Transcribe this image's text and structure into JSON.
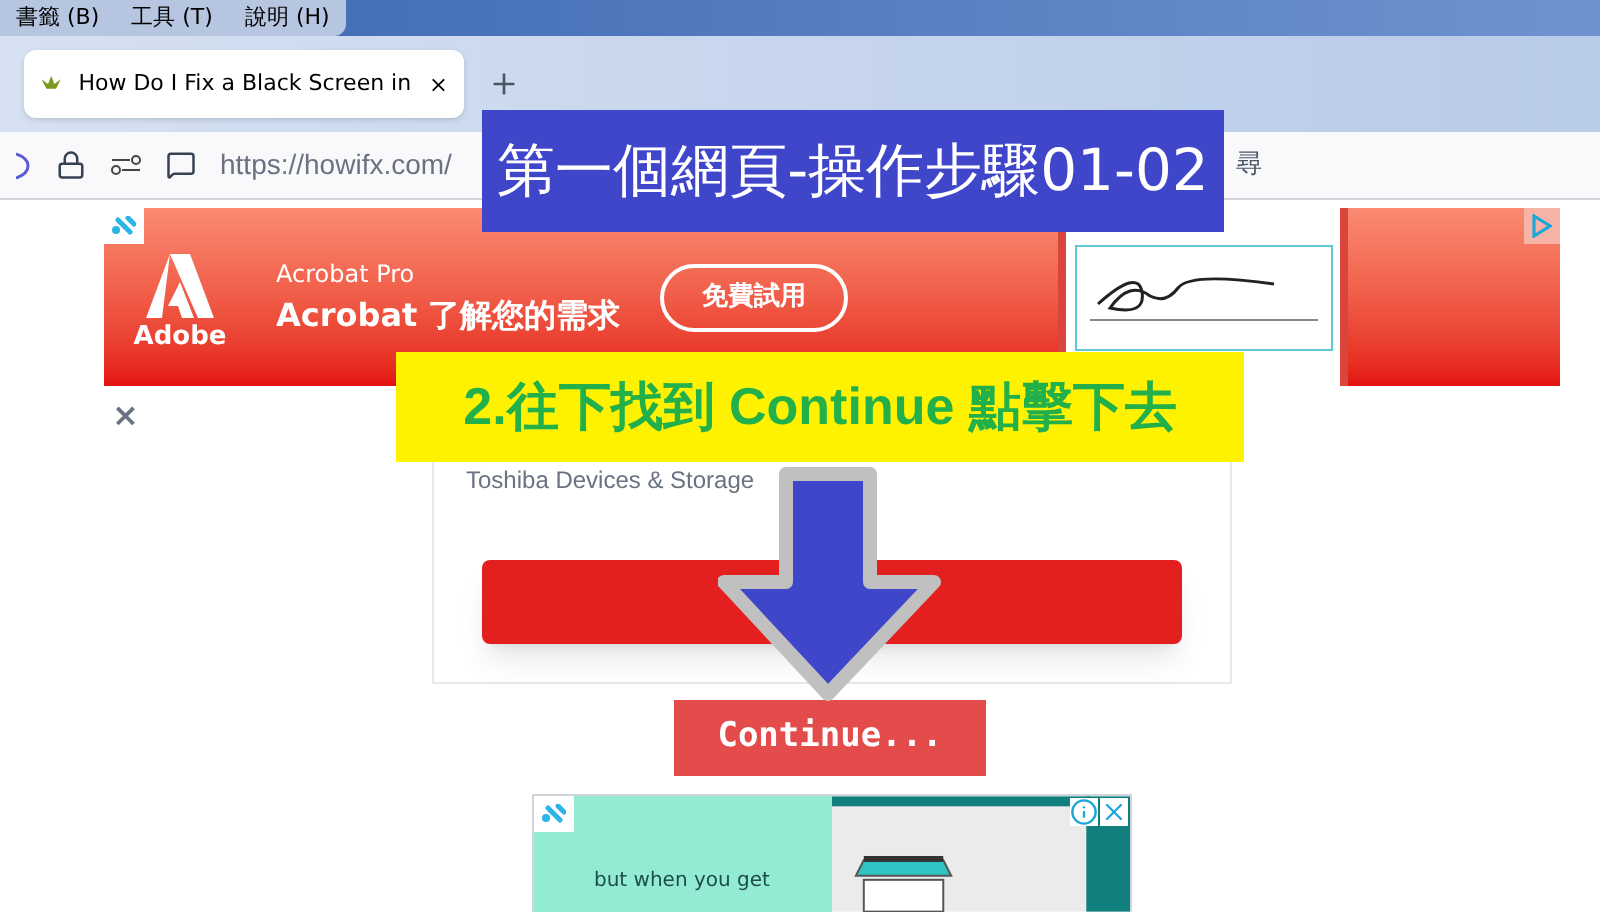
{
  "menu_bar": [
    "書籤 (B)",
    "工具 (T)",
    "說明 (H)"
  ],
  "tabs": [
    {
      "title": "How Do I Fix a Black Screen in",
      "selected": true
    }
  ],
  "address_bar": {
    "url": "https://howifx.com/",
    "search_fragment": "尋"
  },
  "top_ad": {
    "product": "Acrobat Pro",
    "headline": "Acrobat 了解您的需求",
    "button": "免費試用",
    "brand": "Adobe",
    "close": "×"
  },
  "card": {
    "title": "Toshiba Devices & Storage"
  },
  "continue_button": "Continue...",
  "bottom_ad": {
    "text": "but when you get"
  },
  "annotations": [
    {
      "kind": "title",
      "text": "第一個網頁-操作步驟01-02"
    },
    {
      "kind": "hint",
      "text": "2.往下找到 Continue 點擊下去"
    }
  ]
}
